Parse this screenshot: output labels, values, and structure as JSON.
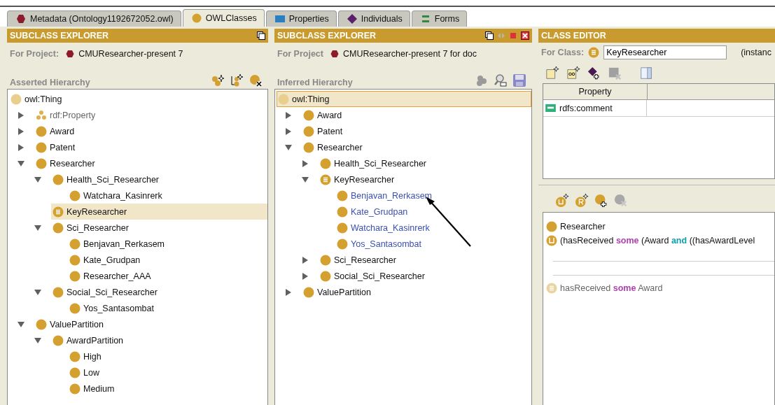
{
  "tabs": [
    {
      "label": "Metadata (Ontology1192672052.owl)",
      "kind": "metadata",
      "selected": false
    },
    {
      "label": "OWLClasses",
      "kind": "classes",
      "selected": true
    },
    {
      "label": "Properties",
      "kind": "properties",
      "selected": false
    },
    {
      "label": "Individuals",
      "kind": "individuals",
      "selected": false
    },
    {
      "label": "Forms",
      "kind": "forms",
      "selected": false
    }
  ],
  "asserted": {
    "title": "SUBCLASS EXPLORER",
    "project_label": "For Project:",
    "project": "CMUResearcher-present 7",
    "hierarchy_label": "Asserted Hierarchy",
    "tree": [
      {
        "label": "owl:Thing",
        "kind": "thing",
        "selected": false,
        "children": [
          {
            "label": "rdf:Property",
            "kind": "property",
            "expanded": false,
            "selected": false
          },
          {
            "label": "Award",
            "kind": "class",
            "expanded": false,
            "selected": false
          },
          {
            "label": "Patent",
            "kind": "class",
            "expanded": false,
            "selected": false
          },
          {
            "label": "Researcher",
            "kind": "class",
            "expanded": true,
            "selected": false,
            "children": [
              {
                "label": "Health_Sci_Researcher",
                "kind": "class",
                "expanded": true,
                "selected": false,
                "children": [
                  {
                    "label": "Watchara_Kasinrerk",
                    "kind": "class",
                    "selected": false
                  }
                ]
              },
              {
                "label": "KeyResearcher",
                "kind": "defined",
                "selected": true
              },
              {
                "label": "Sci_Researcher",
                "kind": "class",
                "expanded": true,
                "selected": false,
                "children": [
                  {
                    "label": "Benjavan_Rerkasem",
                    "kind": "class",
                    "selected": false
                  },
                  {
                    "label": "Kate_Grudpan",
                    "kind": "class",
                    "selected": false
                  },
                  {
                    "label": "Researcher_AAA",
                    "kind": "class",
                    "selected": false
                  }
                ]
              },
              {
                "label": "Social_Sci_Researcher",
                "kind": "class",
                "expanded": true,
                "selected": false,
                "children": [
                  {
                    "label": "Yos_Santasombat",
                    "kind": "class",
                    "selected": false
                  }
                ]
              }
            ]
          },
          {
            "label": "ValuePartition",
            "kind": "class",
            "expanded": true,
            "selected": false,
            "children": [
              {
                "label": "AwardPartition",
                "kind": "class",
                "expanded": true,
                "selected": false,
                "children": [
                  {
                    "label": "High",
                    "kind": "class",
                    "selected": false
                  },
                  {
                    "label": "Low",
                    "kind": "class",
                    "selected": false
                  },
                  {
                    "label": "Medium",
                    "kind": "class",
                    "selected": false
                  }
                ]
              }
            ]
          }
        ]
      }
    ]
  },
  "inferred": {
    "title": "SUBCLASS EXPLORER",
    "project_label": "For Project",
    "project": "CMUResearcher-present 7 for doc",
    "hierarchy_label": "Inferred Hierarchy",
    "tree": [
      {
        "label": "owl:Thing",
        "kind": "thing",
        "selected": true,
        "children": [
          {
            "label": "Award",
            "kind": "class",
            "expanded": false,
            "selected": false
          },
          {
            "label": "Patent",
            "kind": "class",
            "expanded": false,
            "selected": false
          },
          {
            "label": "Researcher",
            "kind": "class",
            "expanded": true,
            "selected": false,
            "children": [
              {
                "label": "Health_Sci_Researcher",
                "kind": "class",
                "expanded": false,
                "selected": false
              },
              {
                "label": "KeyResearcher",
                "kind": "defined",
                "expanded": true,
                "selected": false,
                "children": [
                  {
                    "label": "Benjavan_Rerkasem",
                    "kind": "class",
                    "inferred": true,
                    "selected": false
                  },
                  {
                    "label": "Kate_Grudpan",
                    "kind": "class",
                    "inferred": true,
                    "selected": false
                  },
                  {
                    "label": "Watchara_Kasinrerk",
                    "kind": "class",
                    "inferred": true,
                    "selected": false
                  },
                  {
                    "label": "Yos_Santasombat",
                    "kind": "class",
                    "inferred": true,
                    "selected": false
                  }
                ]
              },
              {
                "label": "Sci_Researcher",
                "kind": "class",
                "expanded": false,
                "selected": false
              },
              {
                "label": "Social_Sci_Researcher",
                "kind": "class",
                "expanded": false,
                "selected": false
              }
            ]
          },
          {
            "label": "ValuePartition",
            "kind": "class",
            "expanded": false,
            "selected": false
          }
        ]
      }
    ]
  },
  "class_editor": {
    "title": "CLASS EDITOR",
    "class_label": "For Class:",
    "class_name": "KeyResearcher",
    "instances_label": "(instanc",
    "table": {
      "columns": [
        "Property"
      ],
      "rows": [
        {
          "property": "rdfs:comment"
        }
      ]
    },
    "conditions": [
      {
        "kind": "class",
        "inherited": false,
        "parts": [
          {
            "kind": "text",
            "text": "Researcher"
          }
        ]
      },
      {
        "kind": "union",
        "inherited": false,
        "parts": [
          {
            "kind": "text",
            "text": "(hasReceived"
          },
          {
            "kind": "quantifier",
            "text": "some"
          },
          {
            "kind": "text",
            "text": "(Award"
          },
          {
            "kind": "operator",
            "text": "and"
          },
          {
            "kind": "text",
            "text": "((hasAwardLevel"
          }
        ]
      },
      {
        "kind": "divider"
      },
      {
        "kind": "divider"
      },
      {
        "kind": "defined",
        "inherited": true,
        "parts": [
          {
            "kind": "text",
            "text": "hasReceived"
          },
          {
            "kind": "quantifier",
            "text": "some"
          },
          {
            "kind": "text",
            "text": "Award"
          }
        ]
      }
    ]
  }
}
